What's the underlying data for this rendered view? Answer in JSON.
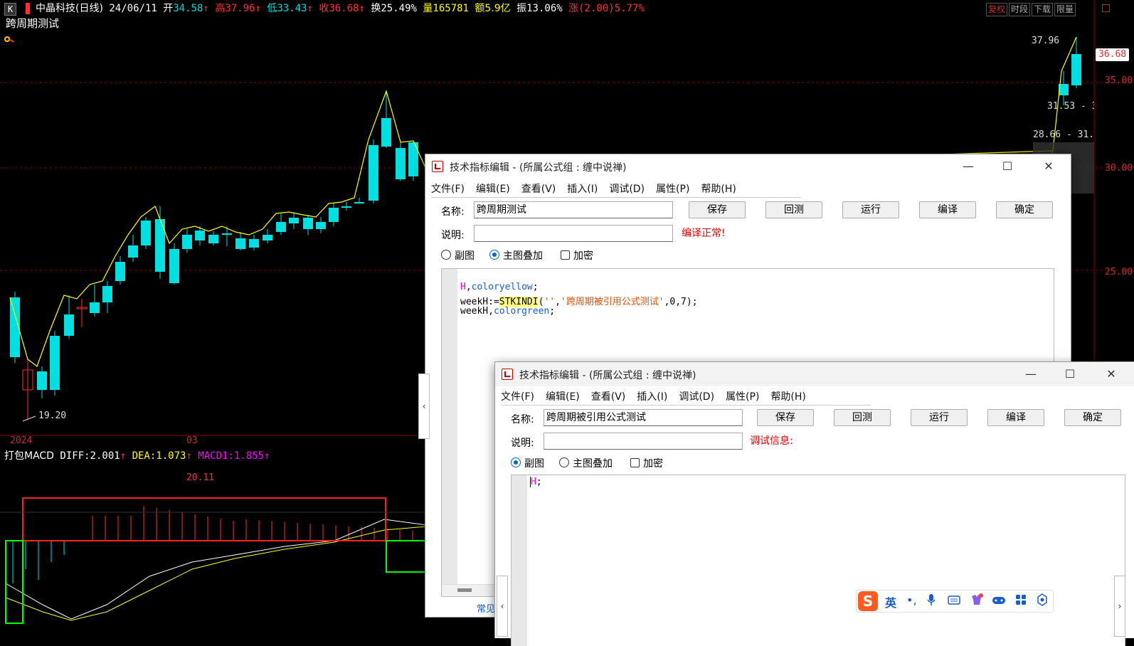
{
  "stock_header": {
    "badge": "K",
    "stock_name": "中晶科技(日线)",
    "date": "24/06/11",
    "open_label": "开",
    "open": "34.58",
    "high_label": "高",
    "high": "37.96",
    "low_label": "低",
    "low": "33.43",
    "close_label": "收",
    "close": "36.68",
    "turnover_label": "换",
    "turnover": "25.49%",
    "volume_label": "量",
    "volume": "165781",
    "amount_label": "额",
    "amount": "5.9亿",
    "amplitude_label": "振",
    "amplitude": "13.06%",
    "change_label": "涨",
    "change": "(2.00)5.77%",
    "arrow": "↑"
  },
  "toolbar_buttons": [
    "复权",
    "时段",
    "下载",
    "限量"
  ],
  "indicator_title": "跨周期测试",
  "price_chart": {
    "low_label": "19.20",
    "high_label": "37.96",
    "current_price": "36.68",
    "ytick_labels": [
      "35.00",
      "30.00",
      "25.00"
    ],
    "xtick_labels": [
      "2024",
      "03"
    ],
    "overlay_labels": [
      "31.53 - 3",
      "28.66 - 31."
    ],
    "colors": {
      "up": "#ff3030",
      "down": "#00e0e0",
      "line": "#ffff00",
      "grid": "#8b0000"
    }
  },
  "macd_panel": {
    "name": "打包MACD",
    "diff_label": "DIFF:2.001",
    "dea_label": "DEA:1.073",
    "macd_label": "MACD1:1.855",
    "arrow": "↑",
    "peak_label": "20.11"
  },
  "dialog1": {
    "title": "技术指标编辑 - (所属公式组 : 缠中说禅)",
    "menu": [
      "文件(F)",
      "编辑(E)",
      "查看(V)",
      "插入(I)",
      "调试(D)",
      "属性(P)",
      "帮助(H)"
    ],
    "name_label": "名称:",
    "name_value": "跨周期测试",
    "desc_label": "说明:",
    "desc_value": "",
    "status": "编译正常!",
    "buttons": [
      "保存",
      "回测",
      "运行",
      "编译",
      "确定"
    ],
    "radio_sub": "副图",
    "radio_main": "主图叠加",
    "check_encrypt": "加密",
    "code": {
      "l1a": "H",
      "l1b": ",",
      "l1c": "coloryellow",
      "l1d": ";",
      "l2a": "weekH:=",
      "l2b": "STKINDI",
      "l2c": "(",
      "l2d": "''",
      "l2e": ",",
      "l2f": "'跨周期被引用公式测试'",
      "l2g": ",",
      "l2h": "0",
      "l2i": ",",
      "l2j": "7",
      "l2k": ");",
      "l3a": "weekH",
      "l3b": ",",
      "l3c": "colorgreen",
      "l3d": ";"
    },
    "footer_text": "常见"
  },
  "dialog2": {
    "title": "技术指标编辑 - (所属公式组 : 缠中说禅)",
    "menu": [
      "文件(F)",
      "编辑(E)",
      "查看(V)",
      "插入(I)",
      "调试(D)",
      "属性(P)",
      "帮助(H)"
    ],
    "name_label": "名称:",
    "name_value": "跨周期被引用公式测试",
    "desc_label": "说明:",
    "desc_value": "",
    "status": "调试信息:",
    "buttons": [
      "保存",
      "回测",
      "运行",
      "编译",
      "确定"
    ],
    "radio_sub": "副图",
    "radio_main": "主图叠加",
    "check_encrypt": "加密",
    "code": {
      "l1a": "H",
      "l1b": ";"
    }
  },
  "ime_toolbar": {
    "lang": "英",
    "punct": "•,",
    "icons": [
      "mic-icon",
      "keyboard-icon",
      "skin-icon",
      "game-icon",
      "apps-icon",
      "tools-icon"
    ]
  }
}
